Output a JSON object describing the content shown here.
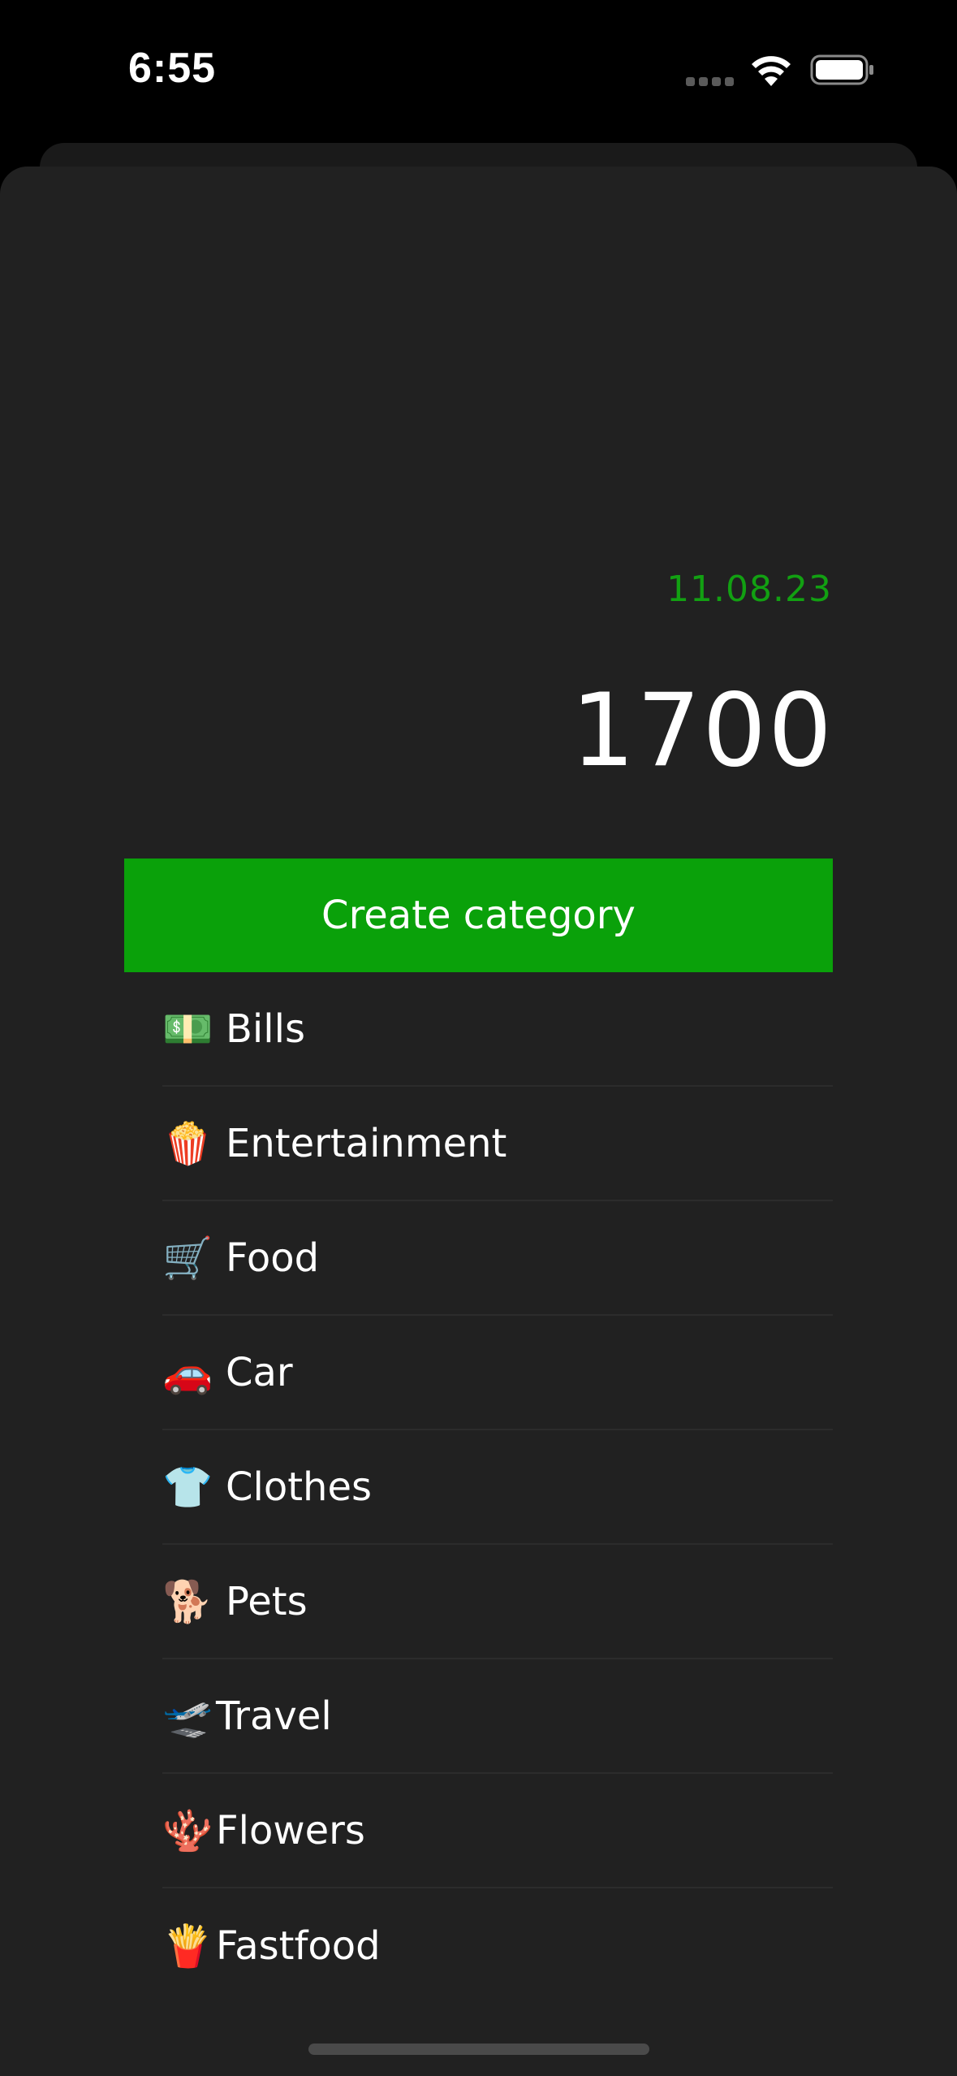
{
  "status_bar": {
    "time": "6:55"
  },
  "header": {
    "date": "11.08.23",
    "amount": "1700"
  },
  "actions": {
    "create_category_label": "Create category"
  },
  "categories": [
    {
      "emoji": "💵",
      "label": "Bills"
    },
    {
      "emoji": "🍿",
      "label": "Entertainment"
    },
    {
      "emoji": "🛒",
      "label": "Food"
    },
    {
      "emoji": "🚗",
      "label": "Car"
    },
    {
      "emoji": "👕",
      "label": "Clothes"
    },
    {
      "emoji": "🐕",
      "label": "Pets"
    },
    {
      "emoji": "🛫",
      "label": "Travel"
    },
    {
      "emoji": "🪸",
      "label": "Flowers"
    },
    {
      "emoji": "🍟",
      "label": "Fastfood"
    }
  ],
  "colors": {
    "accent_green": "#0aa10a",
    "date_green": "#12a012",
    "sheet_background": "#212121",
    "screen_background": "#000000"
  }
}
